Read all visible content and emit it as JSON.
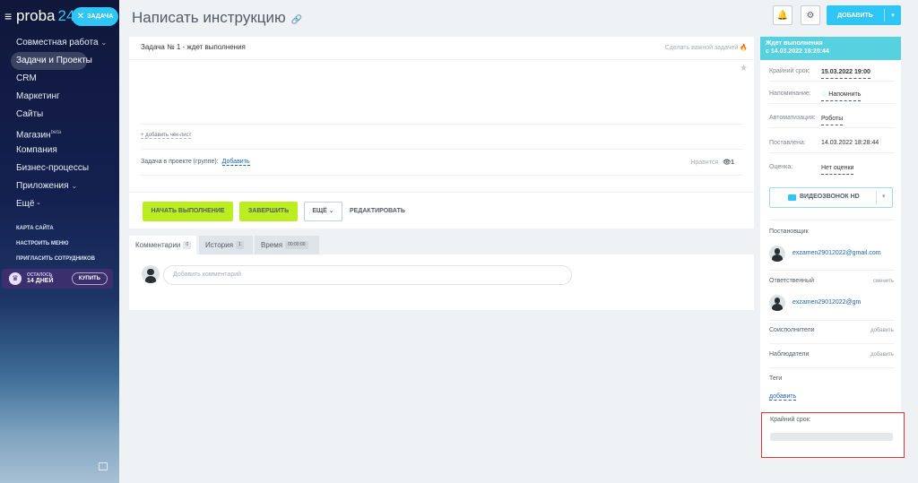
{
  "sidebar": {
    "logo_text": "proba",
    "logo_num": "24",
    "task_button": "ЗАДАЧА",
    "items": [
      {
        "label": "Совместная работа",
        "chevron": true
      },
      {
        "label": "Задачи и Проекты",
        "active": true
      },
      {
        "label": "CRM"
      },
      {
        "label": "Маркетинг"
      },
      {
        "label": "Сайты"
      },
      {
        "label": "Магазин",
        "sup": "beta"
      },
      {
        "label": "Компания"
      },
      {
        "label": "Бизнес-процессы"
      },
      {
        "label": "Приложения",
        "chevron": true
      },
      {
        "label": "Ещё -"
      }
    ],
    "small_links": [
      "КАРТА САЙТА",
      "НАСТРОИТЬ МЕНЮ",
      "ПРИГЛАСИТЬ СОТРУДНИКОВ"
    ],
    "trial": {
      "line1": "ОСТАЛОСЬ",
      "line2": "14 ДНЕЙ",
      "buy": "КУПИТЬ"
    }
  },
  "header": {
    "title": "Написать инструкцию",
    "add_button": "ДОБАВИТЬ"
  },
  "task": {
    "title": "Задача № 1 - ждет выполнения",
    "important": "Сделать важной задачей",
    "checklist": "+ добавить чек-лист",
    "project_label": "Задача в проекте (группе):",
    "project_add": "Добавить",
    "like_label": "Нравится",
    "like_count": "1",
    "buttons": {
      "start": "НАЧАТЬ ВЫПОЛНЕНИЕ",
      "finish": "ЗАВЕРШИТЬ",
      "more": "ЕЩЁ",
      "edit": "РЕДАКТИРОВАТЬ"
    }
  },
  "tabs": [
    {
      "label": "Комментарии",
      "count": "0"
    },
    {
      "label": "История",
      "count": "1"
    },
    {
      "label": "Время",
      "count": "00:00:00"
    }
  ],
  "comment_placeholder": "Добавить комментарий",
  "panel": {
    "status_line1": "Ждет выполнения",
    "status_line2": "с 14.03.2022 18:20:44",
    "rows": [
      {
        "label": "Крайний срок:",
        "value": "15.03.2022 19:00"
      },
      {
        "label": "Напоминание:",
        "value": "Напомнить"
      },
      {
        "label": "Автоматизация:",
        "value": "Роботы"
      },
      {
        "label": "Поставлена:",
        "value": "14.03.2022 18:28:44"
      },
      {
        "label": "Оценка:",
        "value": "Нет оценки"
      }
    ],
    "video_button": "ВИДЕОЗВОНОК HD",
    "creator_label": "Постановщик",
    "creator_name": "exzamen29012022@gmail.com",
    "responsible_label": "Ответственный",
    "responsible_change": "сменить",
    "responsible_name": "exzamen29012022@gm",
    "coexecutors_label": "Соисполнители",
    "coexecutors_add": "добавить",
    "observers_label": "Наблюдатели",
    "observers_add": "добавить",
    "tags_label": "Теги",
    "tags_add": "добавить",
    "deadline_box_label": "Крайний срок:"
  },
  "colors": {
    "accent": "#2fc6f6",
    "green_button": "#bbed21",
    "status_bg": "#56d1e0",
    "highlight_border": "#e0303a"
  }
}
